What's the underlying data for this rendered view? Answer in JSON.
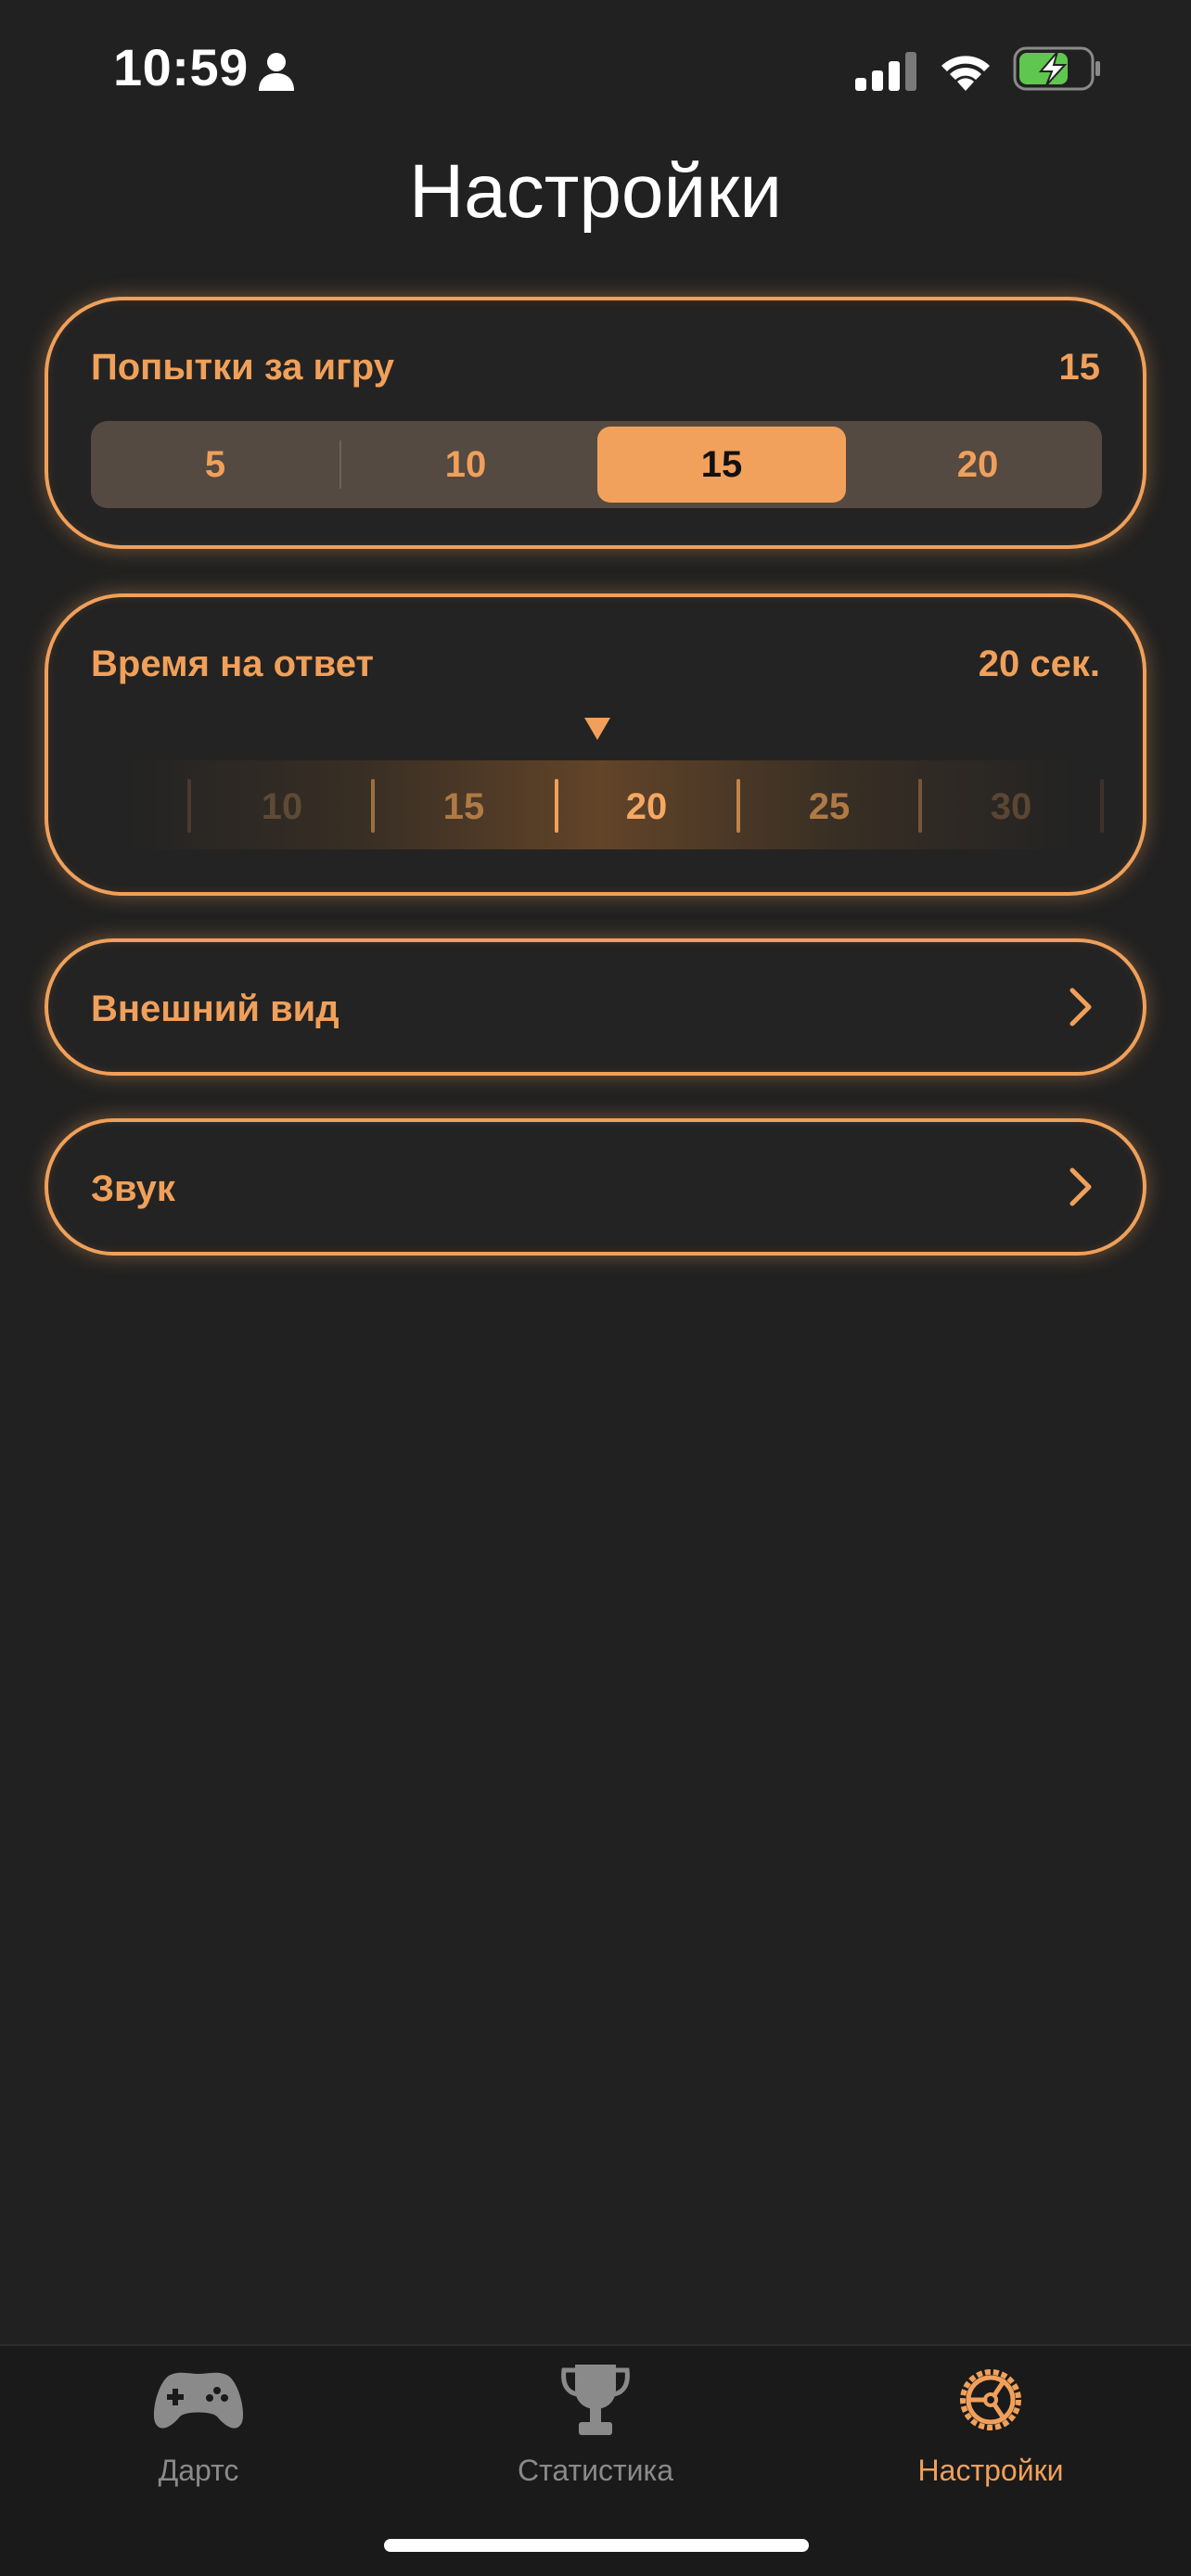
{
  "status_bar": {
    "time": "10:59",
    "icons": [
      "person-icon",
      "cellular-signal-icon",
      "wifi-icon",
      "battery-charging-icon"
    ]
  },
  "page": {
    "title": "Настройки"
  },
  "attempts": {
    "label": "Попытки за игру",
    "value": "15",
    "options": [
      "5",
      "10",
      "15",
      "20"
    ],
    "selected": "15"
  },
  "answer_time": {
    "label": "Время на ответ",
    "value": "20 сек.",
    "ruler_labels": [
      "10",
      "15",
      "20",
      "25",
      "30"
    ],
    "selected": "20"
  },
  "menu": {
    "appearance": "Внешний вид",
    "sound": "Звук"
  },
  "tab_bar": {
    "tabs": [
      {
        "label": "Дартс",
        "icon": "gamecontroller-icon",
        "active": false
      },
      {
        "label": "Статистика",
        "icon": "trophy-icon",
        "active": false
      },
      {
        "label": "Настройки",
        "icon": "steering-wheel-icon",
        "active": true
      }
    ]
  },
  "colors": {
    "accent": "#f0a05a",
    "background": "#212121",
    "inactive_tab": "#8a8a8a"
  }
}
